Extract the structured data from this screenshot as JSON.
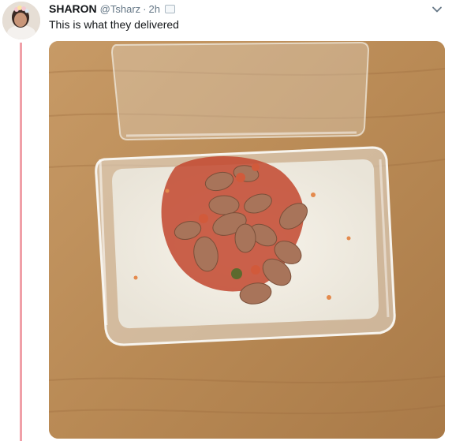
{
  "tweet": {
    "display_name": "SHARON",
    "handle": "@Tsharz",
    "separator": "·",
    "time": "2h",
    "text": "This is what they delivered",
    "has_media_badge": true
  },
  "icons": {
    "caret": "chevron-down-icon",
    "media_badge": "photo-icon"
  },
  "colors": {
    "thread_line": "#f0a0a8",
    "name": "#14171a",
    "meta": "#657786"
  }
}
